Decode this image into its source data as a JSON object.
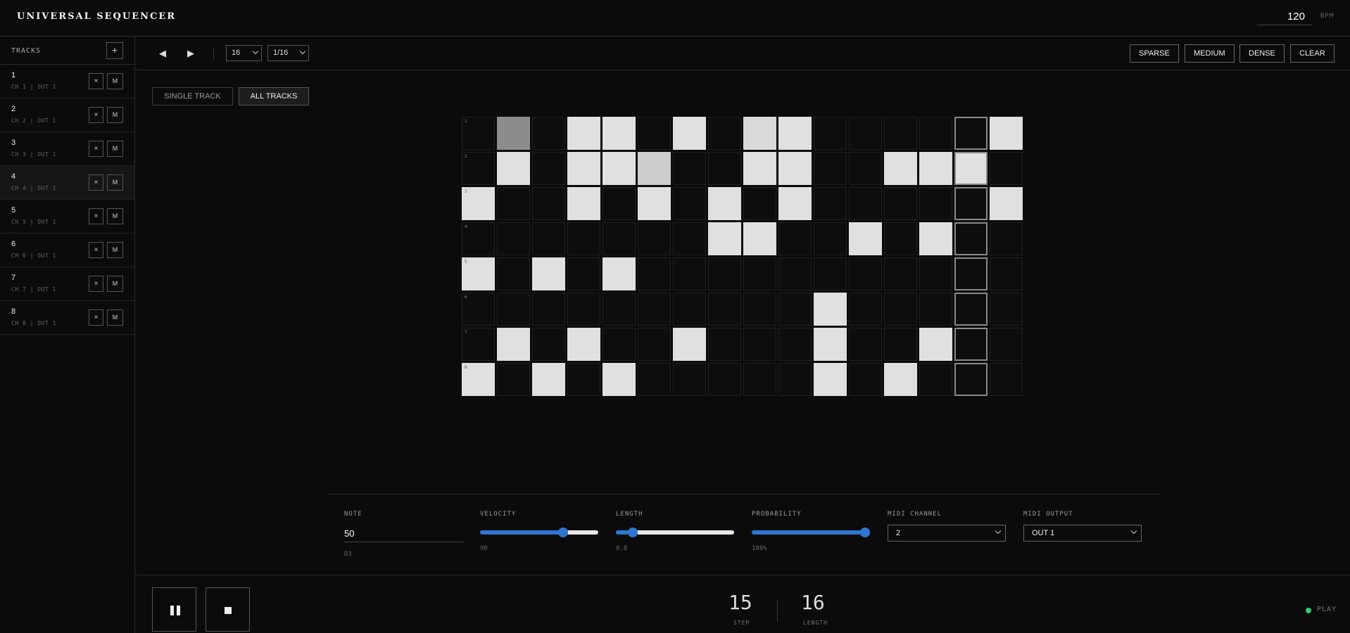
{
  "header": {
    "title": "UNIVERSAL SEQUENCER",
    "bpm_value": "120",
    "bpm_label": "BPM"
  },
  "sidebar": {
    "title": "TRACKS",
    "add_label": "+",
    "selected_index": 3,
    "tracks": [
      {
        "num": "1",
        "info": "CH 1 | OUT 1",
        "del": "×",
        "mute": "M"
      },
      {
        "num": "2",
        "info": "CH 2 | OUT 1",
        "del": "×",
        "mute": "M"
      },
      {
        "num": "3",
        "info": "CH 3 | OUT 1",
        "del": "×",
        "mute": "M"
      },
      {
        "num": "4",
        "info": "CH 4 | OUT 1",
        "del": "×",
        "mute": "M"
      },
      {
        "num": "5",
        "info": "CH 5 | OUT 1",
        "del": "×",
        "mute": "M"
      },
      {
        "num": "6",
        "info": "CH 6 | OUT 1",
        "del": "×",
        "mute": "M"
      },
      {
        "num": "7",
        "info": "CH 7 | OUT 1",
        "del": "×",
        "mute": "M"
      },
      {
        "num": "8",
        "info": "CH 8 | OUT 1",
        "del": "×",
        "mute": "M"
      }
    ]
  },
  "toolbar": {
    "prev_icon": "◀",
    "next_icon": "▶",
    "steps_value": "16",
    "division_value": "1/16",
    "presets": [
      "SPARSE",
      "MEDIUM",
      "DENSE",
      "CLEAR"
    ]
  },
  "view": {
    "single": "SINGLE TRACK",
    "all": "ALL TRACKS",
    "active": "all"
  },
  "grid": {
    "current_step": 14,
    "rows": [
      {
        "label": "1",
        "steps": [
          0,
          0.55,
          0,
          0.88,
          0.88,
          0,
          0.88,
          0,
          0.85,
          0.88,
          0,
          0,
          0,
          0,
          0,
          0.88
        ]
      },
      {
        "label": "2",
        "steps": [
          0,
          0.88,
          0,
          0.88,
          0.88,
          0.8,
          0,
          0,
          0.88,
          0.88,
          0,
          0,
          0.88,
          0.88,
          0.88,
          0
        ]
      },
      {
        "label": "3",
        "steps": [
          0.88,
          0,
          0,
          0.88,
          0,
          0.88,
          0,
          0.88,
          0,
          0.88,
          0,
          0,
          0,
          0,
          0,
          0.88
        ]
      },
      {
        "label": "4",
        "steps": [
          0,
          0,
          0,
          0,
          0,
          0,
          0,
          0.88,
          0.88,
          0,
          0,
          0.88,
          0,
          0.88,
          0,
          0
        ]
      },
      {
        "label": "5",
        "steps": [
          0.88,
          0,
          0.88,
          0,
          0.88,
          0,
          0,
          0,
          0,
          0,
          0,
          0,
          0,
          0,
          0,
          0
        ]
      },
      {
        "label": "6",
        "steps": [
          0,
          0,
          0,
          0,
          0,
          0,
          0,
          0,
          0,
          0,
          0.88,
          0,
          0,
          0,
          0,
          0
        ]
      },
      {
        "label": "7",
        "steps": [
          0,
          0.88,
          0,
          0.88,
          0,
          0,
          0.88,
          0,
          0,
          0,
          0.88,
          0,
          0,
          0.88,
          0,
          0
        ]
      },
      {
        "label": "8",
        "steps": [
          0.88,
          0,
          0.88,
          0,
          0.88,
          0,
          0,
          0,
          0,
          0,
          0.88,
          0,
          0.88,
          0,
          0,
          0
        ]
      }
    ]
  },
  "params": {
    "note": {
      "label": "NOTE",
      "value": "50",
      "name": "D3"
    },
    "velocity": {
      "label": "VELOCITY",
      "value": "90",
      "fraction": 0.7
    },
    "length": {
      "label": "LENGTH",
      "value": "0.8",
      "fraction": 0.14
    },
    "probability": {
      "label": "PROBABILITY",
      "value": "100%",
      "fraction": 1.0
    },
    "midi_channel": {
      "label": "MIDI CHANNEL",
      "value": "2"
    },
    "midi_output": {
      "label": "MIDI OUTPUT",
      "value": "OUT 1"
    }
  },
  "footer": {
    "step_value": "15",
    "step_label": "STEP",
    "length_value": "16",
    "length_label": "LENGTH",
    "status": "PLAY",
    "status_color": "#2ecc71"
  }
}
